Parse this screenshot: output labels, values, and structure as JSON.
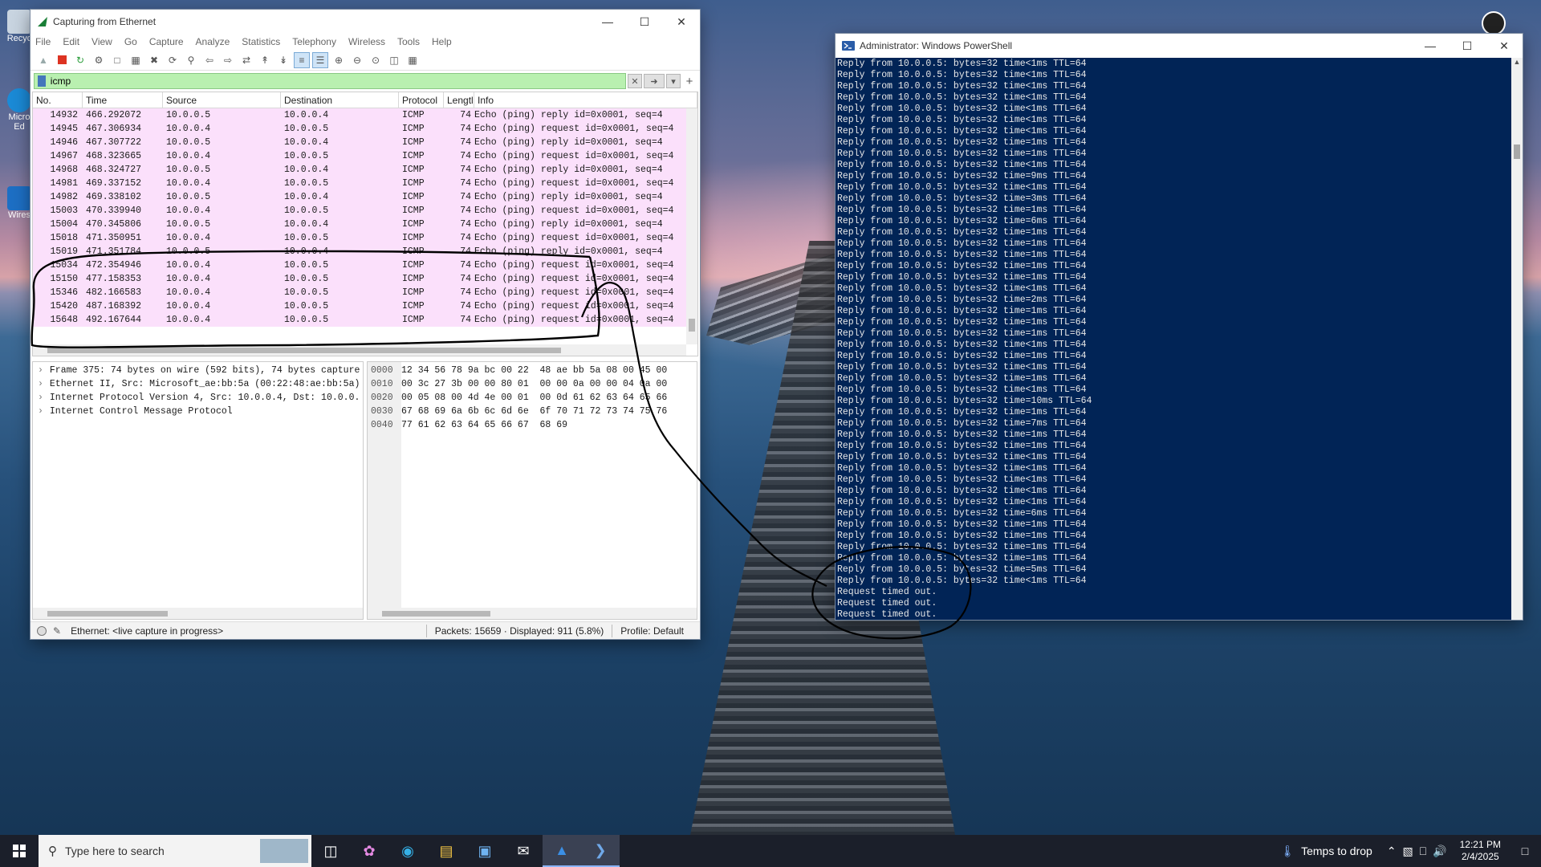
{
  "desktop": {
    "icons": [
      {
        "label": "Recycle Bin",
        "short": "Recyc"
      },
      {
        "label": "Microsoft Edge",
        "short": "Micro Ed"
      },
      {
        "label": "Wireshark",
        "short": "Wires"
      }
    ]
  },
  "wireshark": {
    "title": "Capturing from Ethernet",
    "menu": [
      "File",
      "Edit",
      "View",
      "Go",
      "Capture",
      "Analyze",
      "Statistics",
      "Telephony",
      "Wireless",
      "Tools",
      "Help"
    ],
    "filter": "icmp",
    "columns": [
      "No.",
      "Time",
      "Source",
      "Destination",
      "Protocol",
      "Lengtl",
      "Info"
    ],
    "packets": [
      [
        "14932",
        "466.292072",
        "10.0.0.5",
        "10.0.0.4",
        "ICMP",
        "74",
        "Echo (ping) reply    id=0x0001, seq=4"
      ],
      [
        "14945",
        "467.306934",
        "10.0.0.4",
        "10.0.0.5",
        "ICMP",
        "74",
        "Echo (ping) request  id=0x0001, seq=4"
      ],
      [
        "14946",
        "467.307722",
        "10.0.0.5",
        "10.0.0.4",
        "ICMP",
        "74",
        "Echo (ping) reply    id=0x0001, seq=4"
      ],
      [
        "14967",
        "468.323665",
        "10.0.0.4",
        "10.0.0.5",
        "ICMP",
        "74",
        "Echo (ping) request  id=0x0001, seq=4"
      ],
      [
        "14968",
        "468.324727",
        "10.0.0.5",
        "10.0.0.4",
        "ICMP",
        "74",
        "Echo (ping) reply    id=0x0001, seq=4"
      ],
      [
        "14981",
        "469.337152",
        "10.0.0.4",
        "10.0.0.5",
        "ICMP",
        "74",
        "Echo (ping) request  id=0x0001, seq=4"
      ],
      [
        "14982",
        "469.338102",
        "10.0.0.5",
        "10.0.0.4",
        "ICMP",
        "74",
        "Echo (ping) reply    id=0x0001, seq=4"
      ],
      [
        "15003",
        "470.339940",
        "10.0.0.4",
        "10.0.0.5",
        "ICMP",
        "74",
        "Echo (ping) request  id=0x0001, seq=4"
      ],
      [
        "15004",
        "470.345806",
        "10.0.0.5",
        "10.0.0.4",
        "ICMP",
        "74",
        "Echo (ping) reply    id=0x0001, seq=4"
      ],
      [
        "15018",
        "471.350951",
        "10.0.0.4",
        "10.0.0.5",
        "ICMP",
        "74",
        "Echo (ping) request  id=0x0001, seq=4"
      ],
      [
        "15019",
        "471.351784",
        "10.0.0.5",
        "10.0.0.4",
        "ICMP",
        "74",
        "Echo (ping) reply    id=0x0001, seq=4"
      ],
      [
        "15034",
        "472.354946",
        "10.0.0.4",
        "10.0.0.5",
        "ICMP",
        "74",
        "Echo (ping) request  id=0x0001, seq=4"
      ],
      [
        "15150",
        "477.158353",
        "10.0.0.4",
        "10.0.0.5",
        "ICMP",
        "74",
        "Echo (ping) request  id=0x0001, seq=4"
      ],
      [
        "15346",
        "482.166583",
        "10.0.0.4",
        "10.0.0.5",
        "ICMP",
        "74",
        "Echo (ping) request  id=0x0001, seq=4"
      ],
      [
        "15420",
        "487.168392",
        "10.0.0.4",
        "10.0.0.5",
        "ICMP",
        "74",
        "Echo (ping) request  id=0x0001, seq=4"
      ],
      [
        "15648",
        "492.167644",
        "10.0.0.4",
        "10.0.0.5",
        "ICMP",
        "74",
        "Echo (ping) request  id=0x0001, seq=4"
      ]
    ],
    "details": [
      "Frame 375: 74 bytes on wire (592 bits), 74 bytes capture",
      "Ethernet II, Src: Microsoft_ae:bb:5a (00:22:48:ae:bb:5a)",
      "Internet Protocol Version 4, Src: 10.0.0.4, Dst: 10.0.0.",
      "Internet Control Message Protocol"
    ],
    "hex": [
      {
        "off": "0000",
        "data": "12 34 56 78 9a bc 00 22  48 ae bb 5a 08 00 45 00"
      },
      {
        "off": "0010",
        "data": "00 3c 27 3b 00 00 80 01  00 00 0a 00 00 04 0a 00"
      },
      {
        "off": "0020",
        "data": "00 05 08 00 4d 4e 00 01  00 0d 61 62 63 64 65 66"
      },
      {
        "off": "0030",
        "data": "67 68 69 6a 6b 6c 6d 6e  6f 70 71 72 73 74 75 76"
      },
      {
        "off": "0040",
        "data": "77 61 62 63 64 65 66 67  68 69"
      }
    ],
    "status": {
      "interface": "Ethernet: <live capture in progress>",
      "packets": "Packets: 15659 · Displayed: 911 (5.8%)",
      "profile": "Profile: Default"
    }
  },
  "powershell": {
    "title": "Administrator: Windows PowerShell",
    "lines": [
      "Reply from 10.0.0.5: bytes=32 time<1ms TTL=64",
      "Reply from 10.0.0.5: bytes=32 time<1ms TTL=64",
      "Reply from 10.0.0.5: bytes=32 time<1ms TTL=64",
      "Reply from 10.0.0.5: bytes=32 time<1ms TTL=64",
      "Reply from 10.0.0.5: bytes=32 time<1ms TTL=64",
      "Reply from 10.0.0.5: bytes=32 time<1ms TTL=64",
      "Reply from 10.0.0.5: bytes=32 time<1ms TTL=64",
      "Reply from 10.0.0.5: bytes=32 time=1ms TTL=64",
      "Reply from 10.0.0.5: bytes=32 time=1ms TTL=64",
      "Reply from 10.0.0.5: bytes=32 time<1ms TTL=64",
      "Reply from 10.0.0.5: bytes=32 time=9ms TTL=64",
      "Reply from 10.0.0.5: bytes=32 time<1ms TTL=64",
      "Reply from 10.0.0.5: bytes=32 time=3ms TTL=64",
      "Reply from 10.0.0.5: bytes=32 time=1ms TTL=64",
      "Reply from 10.0.0.5: bytes=32 time=6ms TTL=64",
      "Reply from 10.0.0.5: bytes=32 time=1ms TTL=64",
      "Reply from 10.0.0.5: bytes=32 time=1ms TTL=64",
      "Reply from 10.0.0.5: bytes=32 time=1ms TTL=64",
      "Reply from 10.0.0.5: bytes=32 time=1ms TTL=64",
      "Reply from 10.0.0.5: bytes=32 time=1ms TTL=64",
      "Reply from 10.0.0.5: bytes=32 time<1ms TTL=64",
      "Reply from 10.0.0.5: bytes=32 time=2ms TTL=64",
      "Reply from 10.0.0.5: bytes=32 time=1ms TTL=64",
      "Reply from 10.0.0.5: bytes=32 time=1ms TTL=64",
      "Reply from 10.0.0.5: bytes=32 time=1ms TTL=64",
      "Reply from 10.0.0.5: bytes=32 time<1ms TTL=64",
      "Reply from 10.0.0.5: bytes=32 time=1ms TTL=64",
      "Reply from 10.0.0.5: bytes=32 time<1ms TTL=64",
      "Reply from 10.0.0.5: bytes=32 time=1ms TTL=64",
      "Reply from 10.0.0.5: bytes=32 time<1ms TTL=64",
      "Reply from 10.0.0.5: bytes=32 time=10ms TTL=64",
      "Reply from 10.0.0.5: bytes=32 time=1ms TTL=64",
      "Reply from 10.0.0.5: bytes=32 time=7ms TTL=64",
      "Reply from 10.0.0.5: bytes=32 time=1ms TTL=64",
      "Reply from 10.0.0.5: bytes=32 time=1ms TTL=64",
      "Reply from 10.0.0.5: bytes=32 time<1ms TTL=64",
      "Reply from 10.0.0.5: bytes=32 time<1ms TTL=64",
      "Reply from 10.0.0.5: bytes=32 time<1ms TTL=64",
      "Reply from 10.0.0.5: bytes=32 time<1ms TTL=64",
      "Reply from 10.0.0.5: bytes=32 time<1ms TTL=64",
      "Reply from 10.0.0.5: bytes=32 time=6ms TTL=64",
      "Reply from 10.0.0.5: bytes=32 time=1ms TTL=64",
      "Reply from 10.0.0.5: bytes=32 time=1ms TTL=64",
      "Reply from 10.0.0.5: bytes=32 time=1ms TTL=64",
      "Reply from 10.0.0.5: bytes=32 time=1ms TTL=64",
      "Reply from 10.0.0.5: bytes=32 time=5ms TTL=64",
      "Reply from 10.0.0.5: bytes=32 time<1ms TTL=64",
      "Request timed out.",
      "Request timed out.",
      "Request timed out.",
      "Request timed out."
    ]
  },
  "taskbar": {
    "search_placeholder": "Type here to search",
    "weather": "Temps to drop",
    "time": "12:21 PM",
    "date": "2/4/2025"
  },
  "colors": {
    "packet_row": "#fbe0fb",
    "filter_ok": "#b9f0b0",
    "powershell_bg": "#012456"
  }
}
